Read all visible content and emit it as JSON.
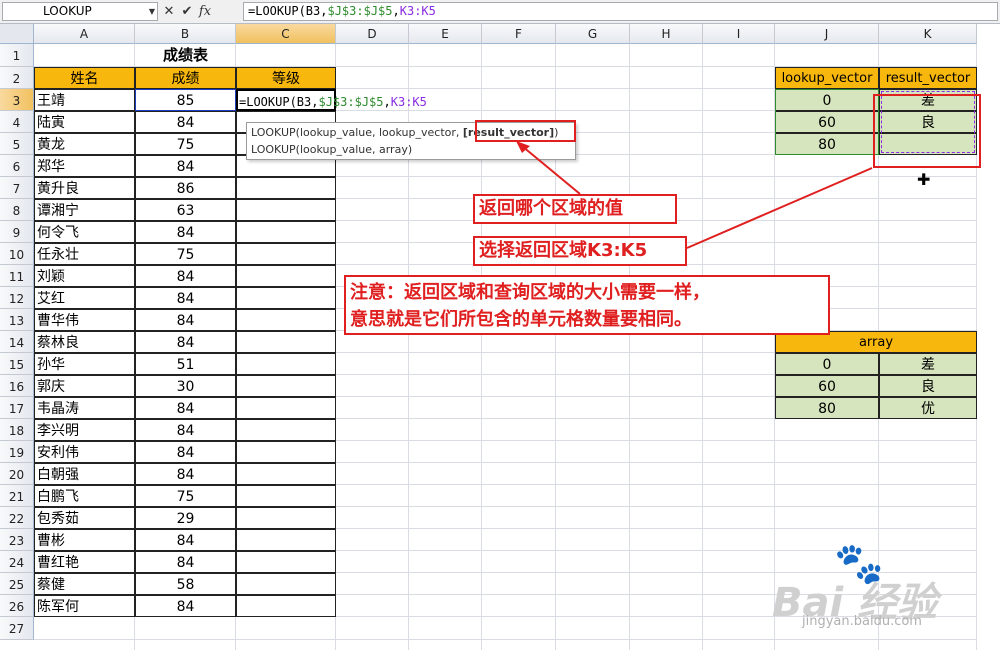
{
  "formula_bar": {
    "name_box": "LOOKUP",
    "cancel_icon": "✕",
    "enter_icon": "✔",
    "fx_label": "fx",
    "formula_prefix": "=LOOKUP(B3,",
    "formula_ref1": "$J$3:$J$5",
    "formula_sep": ",",
    "formula_ref2": "K3:K5"
  },
  "columns": [
    "A",
    "B",
    "C",
    "D",
    "E",
    "F",
    "G",
    "H",
    "I",
    "J",
    "K"
  ],
  "rows": [
    "1",
    "2",
    "3",
    "4",
    "5",
    "6",
    "7",
    "8",
    "9",
    "10",
    "11",
    "12",
    "13",
    "14",
    "15",
    "16",
    "17",
    "18",
    "19",
    "20",
    "21",
    "22",
    "23",
    "24",
    "25",
    "26",
    "27"
  ],
  "table": {
    "title": "成绩表",
    "headers": [
      "姓名",
      "成绩",
      "等级"
    ],
    "rows": [
      {
        "name": "王靖",
        "score": "85"
      },
      {
        "name": "陆寅",
        "score": "84"
      },
      {
        "name": "黄龙",
        "score": "75"
      },
      {
        "name": "郑华",
        "score": "84"
      },
      {
        "name": "黄升良",
        "score": "86"
      },
      {
        "name": "谭湘宁",
        "score": "63"
      },
      {
        "name": "何令飞",
        "score": "84"
      },
      {
        "name": "任永壮",
        "score": "75"
      },
      {
        "name": "刘颖",
        "score": "84"
      },
      {
        "name": "艾红",
        "score": "84"
      },
      {
        "name": "曹华伟",
        "score": "84"
      },
      {
        "name": "蔡林良",
        "score": "84"
      },
      {
        "name": "孙华",
        "score": "51"
      },
      {
        "name": "郭庆",
        "score": "30"
      },
      {
        "name": "韦晶涛",
        "score": "84"
      },
      {
        "name": "李兴明",
        "score": "84"
      },
      {
        "name": "安利伟",
        "score": "84"
      },
      {
        "name": "白朝强",
        "score": "84"
      },
      {
        "name": "白鹏飞",
        "score": "75"
      },
      {
        "name": "包秀茹",
        "score": "29"
      },
      {
        "name": "曹彬",
        "score": "84"
      },
      {
        "name": "曹红艳",
        "score": "84"
      },
      {
        "name": "蔡健",
        "score": "58"
      },
      {
        "name": "陈军何",
        "score": "84"
      }
    ],
    "active_cell_formula_prefix": "=LOOKUP(B3,",
    "active_cell_ref1": "$J$3:$J$5",
    "active_cell_sep": ",",
    "active_cell_ref2": "K3:K5"
  },
  "vector_table": {
    "headers": [
      "lookup_vector",
      "result_vector"
    ],
    "rows": [
      [
        "0",
        "差"
      ],
      [
        "60",
        "良"
      ],
      [
        "80",
        ""
      ]
    ]
  },
  "array_table": {
    "header": "array",
    "rows": [
      [
        "0",
        "差"
      ],
      [
        "60",
        "良"
      ],
      [
        "80",
        "优"
      ]
    ]
  },
  "tooltip": {
    "line1_prefix": "LOOKUP(lookup_value, lookup_vector, ",
    "line1_bold": "[result_vector]",
    "line1_suffix": ")",
    "line2": "LOOKUP(lookup_value, array)"
  },
  "annotations": {
    "which_range": "返回哪个区域的值",
    "select_range": "选择返回区域K3:K5",
    "note_line1": "注意：返回区域和查询区域的大小需要一样，",
    "note_line2": "意思就是它们所包含的单元格数量要相同。"
  },
  "watermark": {
    "brand": "Bai 经验",
    "url": "jingyan.baidu.com"
  },
  "colors": {
    "header_orange": "#f8b70d",
    "green_fill": "#d6e5bd",
    "annotation_red": "#e02020",
    "ref_blue": "#1f3fbf",
    "ref_green": "#2e8b2e",
    "ref_purple": "#8a2be2"
  }
}
